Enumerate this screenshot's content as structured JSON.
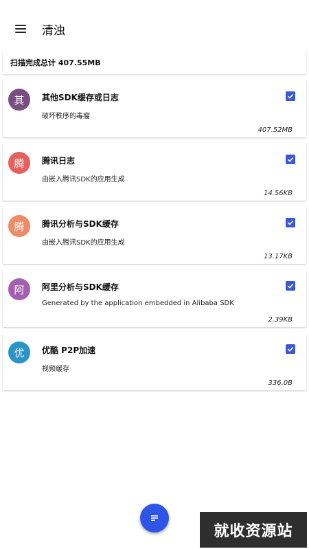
{
  "appbar": {
    "title": "清浊",
    "menu_icon": "hamburger-menu-icon"
  },
  "summary": {
    "text": "扫描完成总计 407.55MB"
  },
  "items": [
    {
      "avatar_char": "其",
      "avatar_color": "#7a4d83",
      "title": "其他SDK缓存或日志",
      "desc": "破坏秩序的毒瘤",
      "size": "407.52MB",
      "checked": true
    },
    {
      "avatar_char": "腾",
      "avatar_color": "#e8605d",
      "title": "腾讯日志",
      "desc": "由嵌入腾讯SDK的应用生成",
      "size": "14.56KB",
      "checked": true
    },
    {
      "avatar_char": "腾",
      "avatar_color": "#ef8a66",
      "title": "腾讯分析与SDK缓存",
      "desc": "由嵌入腾讯SDK的应用生成",
      "size": "13.17KB",
      "checked": true
    },
    {
      "avatar_char": "阿",
      "avatar_color": "#a45fb0",
      "title": "阿里分析与SDK缓存",
      "desc": "Generated by the application embedded in Alibaba SDK",
      "size": "2.39KB",
      "checked": true
    },
    {
      "avatar_char": "优",
      "avatar_color": "#2c93c9",
      "title": "优酷 P2P加速",
      "desc": "视频缓存",
      "size": "336.0B",
      "checked": true
    }
  ],
  "fab": {
    "icon": "clean-list-icon",
    "color": "#2f54e8"
  },
  "watermark": {
    "text": "就收资源站"
  },
  "colors": {
    "checkbox": "#3b59d6"
  }
}
